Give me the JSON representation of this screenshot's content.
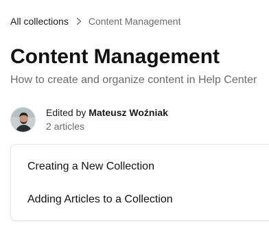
{
  "breadcrumb": {
    "root_label": "All collections",
    "separator_icon": "chevron-right-icon",
    "current_label": "Content Management"
  },
  "collection": {
    "title": "Content Management",
    "description": "How to create and organize content in Help Center"
  },
  "author": {
    "edited_prefix": "Edited by",
    "name": "Mateusz Woźniak",
    "article_count": "2 articles"
  },
  "articles": [
    {
      "title": "Creating a New Collection"
    },
    {
      "title": "Adding Articles to a Collection"
    }
  ],
  "colors": {
    "text_primary": "#111111",
    "text_secondary": "#6b6b6b",
    "card_border": "#e3e3e3"
  }
}
